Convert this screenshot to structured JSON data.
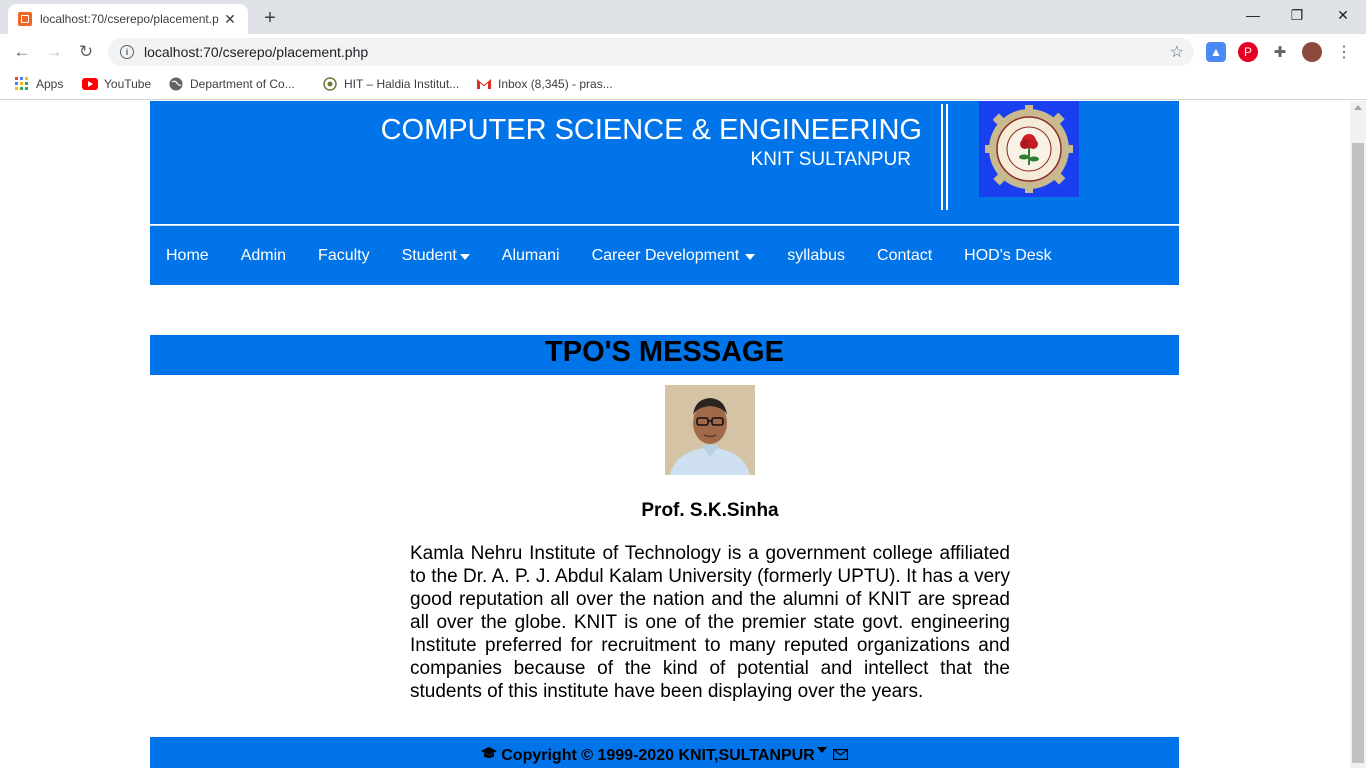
{
  "browser": {
    "tab_title": "localhost:70/cserepo/placement.p",
    "url": "localhost:70/cserepo/placement.php",
    "bookmarks": [
      {
        "label": "Apps",
        "icon": "apps-grid-icon"
      },
      {
        "label": "YouTube",
        "icon": "youtube-icon"
      },
      {
        "label": "Department of Co...",
        "icon": "globe-icon"
      },
      {
        "label": "HIT – Haldia Institut...",
        "icon": "hit-logo-icon"
      },
      {
        "label": "Inbox (8,345) - pras...",
        "icon": "gmail-icon"
      }
    ]
  },
  "header": {
    "title": "COMPUTER SCIENCE & ENGINEERING",
    "subtitle": "KNIT SULTANPUR"
  },
  "nav": {
    "items": [
      {
        "label": "Home",
        "dropdown": false
      },
      {
        "label": "Admin",
        "dropdown": false
      },
      {
        "label": "Faculty",
        "dropdown": false
      },
      {
        "label": "Student",
        "dropdown": true
      },
      {
        "label": "Alumani",
        "dropdown": false
      },
      {
        "label": "Career Development",
        "dropdown": true
      },
      {
        "label": "syllabus",
        "dropdown": false
      },
      {
        "label": "Contact",
        "dropdown": false
      },
      {
        "label": "HOD's Desk",
        "dropdown": false
      }
    ]
  },
  "main": {
    "heading": "TPO'S MESSAGE",
    "name": "Prof. S.K.Sinha",
    "message": "Kamla Nehru Institute of Technology is a government college affiliated to the Dr. A. P. J. Abdul Kalam University (formerly UPTU). It has a very good reputation all over the nation and the alumni of KNIT are spread all over the globe. KNIT is one of the premier state govt. engineering Institute preferred for recruitment to many reputed organizations and companies because of the kind of potential and intellect that the students of this institute have been displaying over the years."
  },
  "footer": {
    "copyright": "Copyright © 1999-2020 KNIT,SULTANPUR"
  },
  "colors": {
    "brand_blue": "#0074e8",
    "logo_blue": "#1a3ff0"
  }
}
